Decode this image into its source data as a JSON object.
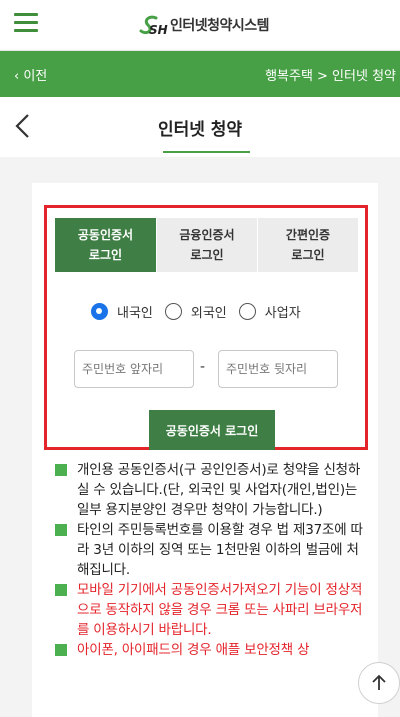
{
  "header": {
    "brand_logo_text": "SH",
    "brand_title": "인터넷청약시스템",
    "icons": {
      "menu": "hamburger-menu-icon",
      "logo": "sh-logo-icon"
    }
  },
  "nav": {
    "back_label": "‹ 이전",
    "breadcrumb": "행복주택 > 인터넷 청약"
  },
  "page": {
    "title": "인터넷 청약"
  },
  "login": {
    "tabs": [
      {
        "line1": "공동인증서",
        "line2": "로그인",
        "active": true
      },
      {
        "line1": "금융인증서",
        "line2": "로그인",
        "active": false
      },
      {
        "line1": "간편인증",
        "line2": "로그인",
        "active": false
      }
    ],
    "radios": [
      {
        "label": "내국인",
        "checked": true
      },
      {
        "label": "외국인",
        "checked": false
      },
      {
        "label": "사업자",
        "checked": false
      }
    ],
    "id_front_placeholder": "주민번호 앞자리",
    "id_back_placeholder": "주민번호 뒷자리",
    "dash": "-",
    "button_label": "공동인증서 로그인"
  },
  "notices": [
    {
      "text": "개인용 공동인증서(구 공인인증서)로 청약을 신청하실 수 있습니다.(단, 외국인 및 사업자(개인,법인)는 일부 용지분양인 경우만 청약이 가능합니다.)",
      "red": false
    },
    {
      "text": "타인의 주민등록번호를 이용할 경우 법 제37조에 따라 3년 이하의 징역 또는 1천만원 이하의 벌금에 처해집니다.",
      "red": false
    },
    {
      "text": "모바일 기기에서 공동인증서가져오기 기능이 정상적으로 동작하지 않을 경우 크롬 또는 사파리 브라우저를 이용하시기 바랍니다.",
      "red": true
    },
    {
      "text": "아이폰, 아이패드의 경우 애플 보안정책 상",
      "red": true
    }
  ],
  "colors": {
    "brand_green": "#47a046",
    "tab_active": "#3f7f45",
    "highlight_red": "#e4242b",
    "radio_blue": "#1a73e8"
  }
}
